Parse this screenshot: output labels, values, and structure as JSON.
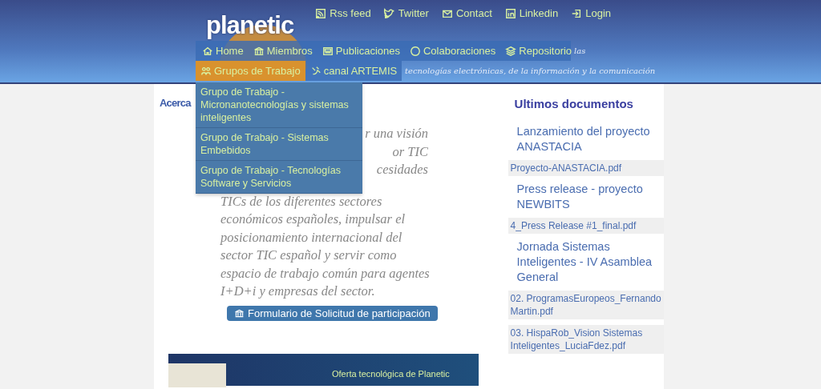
{
  "logo": {
    "text": "planetic"
  },
  "tagline": {
    "visible_end": "las",
    "line_2": "tecnologías electrónicas, de la información y la comunicación"
  },
  "top_links": [
    {
      "kind": "rss",
      "label": "Rss feed"
    },
    {
      "kind": "twitter",
      "label": "Twitter"
    },
    {
      "kind": "mail",
      "label": "Contact"
    },
    {
      "kind": "linkedin",
      "label": "Linkedin"
    },
    {
      "kind": "login",
      "label": "Login"
    }
  ],
  "nav": [
    {
      "kind": "home",
      "label": "Home",
      "selected": false
    },
    {
      "kind": "bank",
      "label": "Miembros",
      "selected": false
    },
    {
      "kind": "news",
      "label": "Publicaciones",
      "selected": false
    },
    {
      "kind": "circle",
      "label": "Colaboraciones",
      "selected": false
    },
    {
      "kind": "layers",
      "label": "Repositorio",
      "selected": false
    },
    {
      "kind": "people",
      "label": "Grupos de Trabajo",
      "selected": true
    },
    {
      "kind": "satellite",
      "label": "canal ARTEMIS",
      "selected": false
    }
  ],
  "dropdown": [
    "Grupo de Trabajo - Micronanotecnologías y sistemas inteligentes",
    "Grupo de Trabajo - Sistemas Embebidos",
    "Grupo de Trabajo - Tecnologías Software y Servicios"
  ],
  "about": {
    "heading": "Acerca",
    "visible_fragments": [
      "r una visión",
      "or TIC",
      "cesidades"
    ],
    "lines": [
      "TICs de los diferentes sectores",
      "económicos españoles, impulsar el",
      "posicionamiento internacional del",
      "sector TIC español y servir como",
      "espacio de trabajo común para agentes",
      "I+D+i y empresas del sector."
    ],
    "button": "Formulario de Solicitud de participación"
  },
  "banner": {
    "text": "Oferta tecnológica de Planetic"
  },
  "latest_docs": {
    "heading": "Ultimos documentos",
    "items": [
      {
        "kind": "title",
        "text": "Lanzamiento del proyecto ANASTACIA"
      },
      {
        "kind": "file",
        "text": "Proyecto-ANASTACIA.pdf"
      },
      {
        "kind": "title",
        "text": "Press release - proyecto NEWBITS"
      },
      {
        "kind": "file",
        "text": "4_Press Release #1_final.pdf"
      },
      {
        "kind": "title",
        "text": "Jornada Sistemas Inteligentes - IV Asamblea General"
      },
      {
        "kind": "file",
        "text": "02. ProgramasEuropeos_Fernando Martin.pdf"
      },
      {
        "kind": "file",
        "text": "03. HispaRob_Vision Sistemas Inteligentes_LuciaFdez.pdf"
      }
    ]
  }
}
